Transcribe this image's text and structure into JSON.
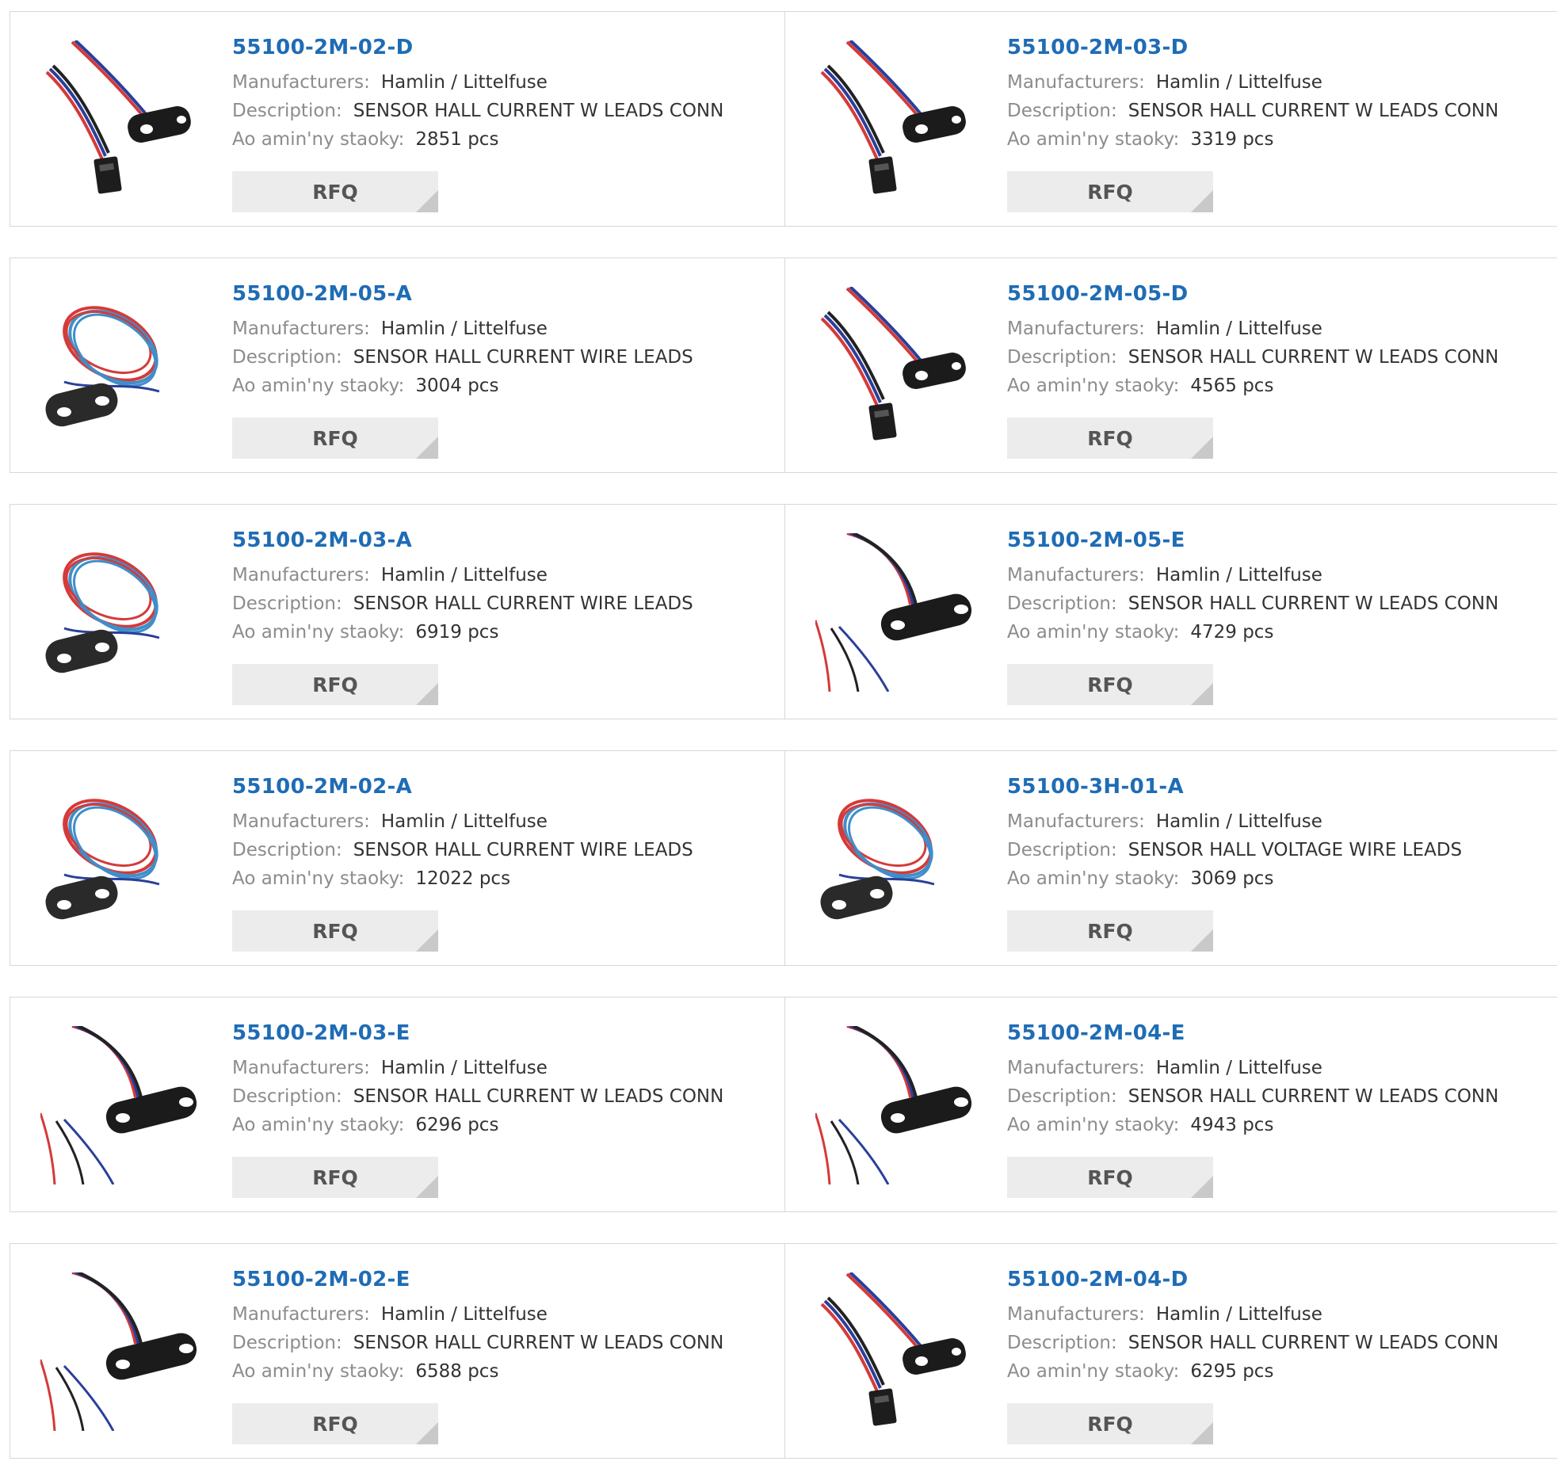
{
  "labels": {
    "manufacturers": "Manufacturers:",
    "description": "Description:",
    "stock": "Ao amin'ny staoky:",
    "rfq": "RFQ"
  },
  "products": [
    {
      "part_number": "55100-2M-02-D",
      "manufacturer": "Hamlin / Littelfuse",
      "description": "SENSOR HALL CURRENT W LEADS CONN",
      "stock": "2851 pcs",
      "image": "sensor-with-connector"
    },
    {
      "part_number": "55100-2M-03-D",
      "manufacturer": "Hamlin / Littelfuse",
      "description": "SENSOR HALL CURRENT W LEADS CONN",
      "stock": "3319 pcs",
      "image": "sensor-with-connector"
    },
    {
      "part_number": "55100-2M-05-A",
      "manufacturer": "Hamlin / Littelfuse",
      "description": "SENSOR HALL CURRENT WIRE LEADS",
      "stock": "3004 pcs",
      "image": "sensor-coiled-wire"
    },
    {
      "part_number": "55100-2M-05-D",
      "manufacturer": "Hamlin / Littelfuse",
      "description": "SENSOR HALL CURRENT W LEADS CONN",
      "stock": "4565 pcs",
      "image": "sensor-with-connector"
    },
    {
      "part_number": "55100-2M-03-A",
      "manufacturer": "Hamlin / Littelfuse",
      "description": "SENSOR HALL CURRENT WIRE LEADS",
      "stock": "6919 pcs",
      "image": "sensor-coiled-wire"
    },
    {
      "part_number": "55100-2M-05-E",
      "manufacturer": "Hamlin / Littelfuse",
      "description": "SENSOR HALL CURRENT W LEADS CONN",
      "stock": "4729 pcs",
      "image": "sensor-loose-wire"
    },
    {
      "part_number": "55100-2M-02-A",
      "manufacturer": "Hamlin / Littelfuse",
      "description": "SENSOR HALL CURRENT WIRE LEADS",
      "stock": "12022 pcs",
      "image": "sensor-coiled-wire"
    },
    {
      "part_number": "55100-3H-01-A",
      "manufacturer": "Hamlin / Littelfuse",
      "description": "SENSOR HALL VOLTAGE WIRE LEADS",
      "stock": "3069 pcs",
      "image": "sensor-coiled-wire"
    },
    {
      "part_number": "55100-2M-03-E",
      "manufacturer": "Hamlin / Littelfuse",
      "description": "SENSOR HALL CURRENT W LEADS CONN",
      "stock": "6296 pcs",
      "image": "sensor-loose-wire"
    },
    {
      "part_number": "55100-2M-04-E",
      "manufacturer": "Hamlin / Littelfuse",
      "description": "SENSOR HALL CURRENT W LEADS CONN",
      "stock": "4943 pcs",
      "image": "sensor-loose-wire"
    },
    {
      "part_number": "55100-2M-02-E",
      "manufacturer": "Hamlin / Littelfuse",
      "description": "SENSOR HALL CURRENT W LEADS CONN",
      "stock": "6588 pcs",
      "image": "sensor-loose-wire"
    },
    {
      "part_number": "55100-2M-04-D",
      "manufacturer": "Hamlin / Littelfuse",
      "description": "SENSOR HALL CURRENT W LEADS CONN",
      "stock": "6295 pcs",
      "image": "sensor-with-connector"
    }
  ]
}
